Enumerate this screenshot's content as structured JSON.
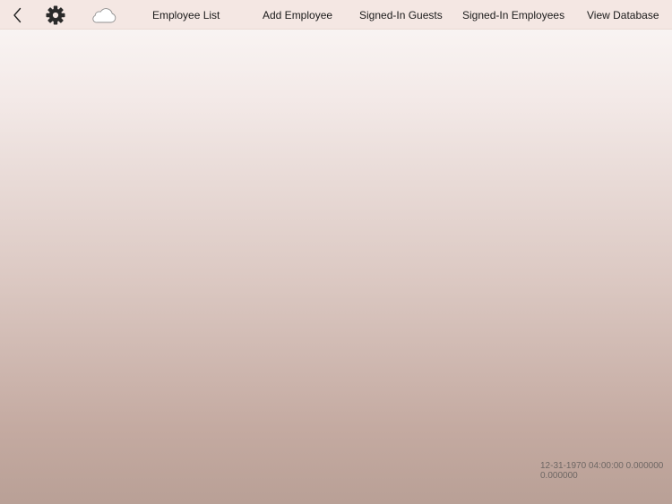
{
  "toolbar": {
    "icons": {
      "back": "chevron-left-icon",
      "settings": "gear-icon",
      "sync": "cloud-icon"
    },
    "nav": {
      "employee_list": "Employee List",
      "add_employee": "Add Employee",
      "signed_in_guests": "Signed-In Guests",
      "signed_in_employees": "Signed-In Employees",
      "view_database": "View Database"
    }
  },
  "footer": {
    "timestamp": "12-31-1970 04:00:00 0.000000 0.000000"
  },
  "colors": {
    "toolbar_bg": "#f4e7e3",
    "text": "#1a1a1a",
    "footer_text": "#6e6764",
    "gradient_top": "#fbf8f7",
    "gradient_bottom": "#b9a096"
  }
}
